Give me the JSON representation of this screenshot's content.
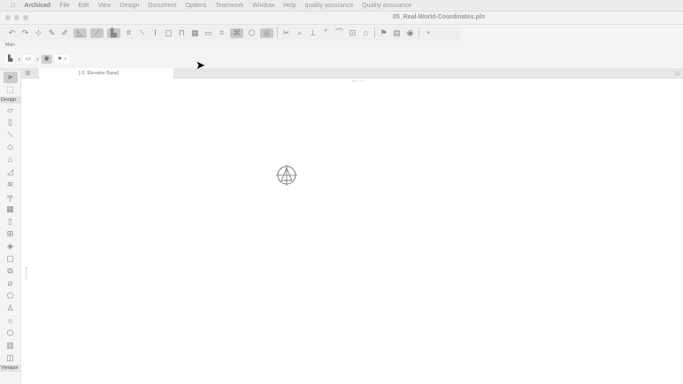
{
  "menubar": {
    "app": "Archicad",
    "items": [
      "File",
      "Edit",
      "View",
      "Design",
      "Document",
      "Options",
      "Teamwork",
      "Window",
      "Help",
      "quality assurance",
      "Quality assurance"
    ]
  },
  "window": {
    "title": "05_Real-World-Coordinates.pln"
  },
  "toolbar": {
    "label": "Main",
    "icons": [
      "undo-icon",
      "redo-icon",
      "pick-up-icon",
      "eyedropper-icon",
      "inject-icon",
      "gravity-icon",
      "guide-icon",
      "snap-icon",
      "grid-icon",
      "line-icon",
      "pen-icon",
      "layer-icon",
      "lock-icon",
      "trace-icon",
      "section-icon",
      "fit-icon",
      "suspend-groups-icon",
      "view-3d-icon",
      "renovation-icon",
      "split-icon",
      "adjust-icon",
      "elevation-icon",
      "intersect-icon",
      "fillet-icon",
      "offset-icon",
      "roof-icon",
      "flag-icon",
      "publish-icon",
      "teamwork-icon",
      "model-icon"
    ]
  },
  "info": {
    "breadcrumbs": [
      "floor-plan",
      "3d-window",
      "orbit",
      "arrow"
    ]
  },
  "tabs": [
    {
      "label": "[-2. Elevator Base]"
    }
  ],
  "toolbox": {
    "sections": [
      "Design",
      "Viewpoi"
    ],
    "tools": [
      "arrow",
      "marquee"
    ],
    "design_tools": [
      "wall",
      "column",
      "beam",
      "slab",
      "roof",
      "shell",
      "stair",
      "railing",
      "curtain-wall",
      "door",
      "window",
      "skylight",
      "opening",
      "object",
      "zone",
      "mesh",
      "morph",
      "lamp",
      "object-3d",
      "curtain-panel",
      "corner-window"
    ]
  }
}
